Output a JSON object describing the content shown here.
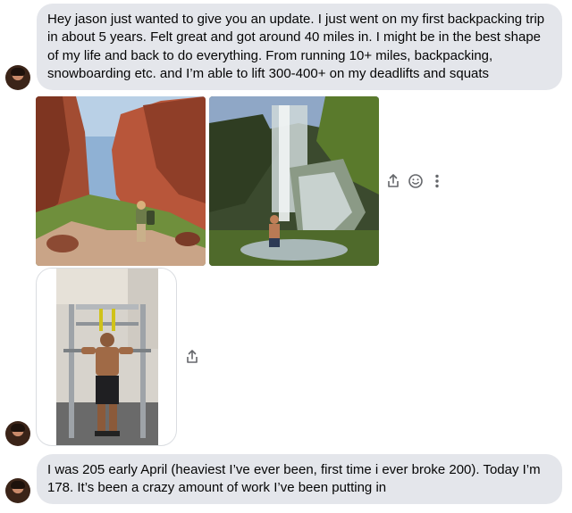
{
  "messages": {
    "first_text": "Hey jason just wanted to give you an update. I just went on my first backpacking trip in about 5 years. Felt great and got around 40 miles in. I might be in the best shape of my life and back to do everything. From running 10+ miles, backpacking, snowboarding etc. and I’m able to lift 300-400+ on my deadlifts and squats",
    "last_text": "I was 205 early April (heaviest I’ve ever been, first time i ever broke 200). Today I’m 178. It’s been a crazy amount of work I’ve been putting in"
  },
  "icons": {
    "share": "share-icon",
    "react": "smiley-icon",
    "more": "more-vertical-icon"
  },
  "colors": {
    "bubble": "#e4e6eb",
    "text": "#050505",
    "icon": "#65676b"
  }
}
